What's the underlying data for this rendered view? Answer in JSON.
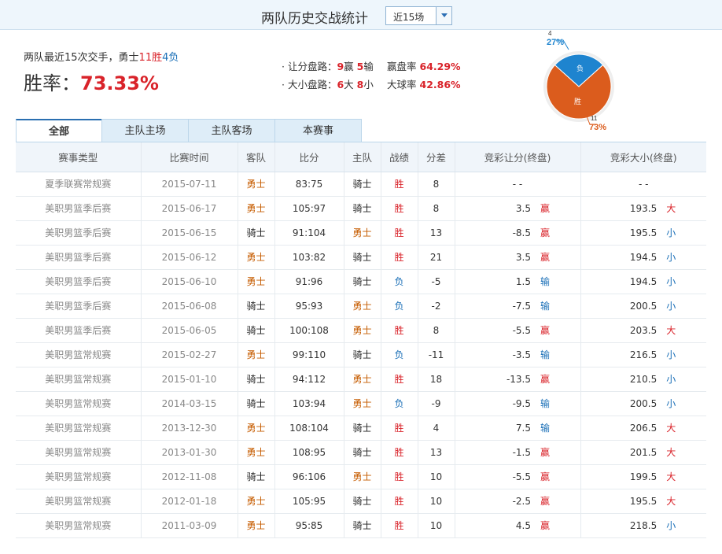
{
  "header": {
    "title": "两队历史交战统计",
    "range_select": {
      "value": "近15场"
    }
  },
  "summary": {
    "prefix": "两队最近15次交手，勇士",
    "wins": "11胜",
    "losses": "4负",
    "winrate_label": "胜率：",
    "winrate_value": "73.33%"
  },
  "stats": {
    "handicap_label": "· 让分盘路：",
    "handicap_win_count": "9",
    "handicap_win_word": "赢",
    "handicap_lose_count": "5",
    "handicap_lose_word": "输",
    "handicap_rate_label": "赢盘率",
    "handicap_rate": "64.29%",
    "ou_label": "· 大小盘路：",
    "ou_big_count": "6",
    "ou_big_word": "大",
    "ou_small_count": "8",
    "ou_small_word": "小",
    "ou_rate_label": "大球率",
    "ou_rate": "42.86%"
  },
  "pie": {
    "colors": {
      "win": "#db5c1d",
      "lose": "#1e84cf"
    },
    "win": {
      "label": "胜",
      "count": "11",
      "percent": "73%",
      "fraction": 0.7333
    },
    "lose": {
      "label": "负",
      "count": "4",
      "percent": "27%",
      "fraction": 0.2667
    }
  },
  "tabs": [
    "全部",
    "主队主场",
    "主队客场",
    "本赛事"
  ],
  "table": {
    "headers": [
      "赛事类型",
      "比赛时间",
      "客队",
      "比分",
      "主队",
      "战绩",
      "分差",
      "竞彩让分(终盘)",
      "竞彩大小(终盘)"
    ],
    "rows": [
      {
        "type": "夏季联赛常规赛",
        "date": "2015-07-11",
        "away": "勇士",
        "score": "83:75",
        "home": "骑士",
        "result": "胜",
        "diff": "8",
        "hc": "- -",
        "hc_mark": "",
        "ou": "- -",
        "ou_mark": ""
      },
      {
        "type": "美职男篮季后赛",
        "date": "2015-06-17",
        "away": "勇士",
        "score": "105:97",
        "home": "骑士",
        "result": "胜",
        "diff": "8",
        "hc": "3.5",
        "hc_mark": "赢",
        "ou": "193.5",
        "ou_mark": "大"
      },
      {
        "type": "美职男篮季后赛",
        "date": "2015-06-15",
        "away": "骑士",
        "score": "91:104",
        "home": "勇士",
        "result": "胜",
        "diff": "13",
        "hc": "-8.5",
        "hc_mark": "赢",
        "ou": "195.5",
        "ou_mark": "小"
      },
      {
        "type": "美职男篮季后赛",
        "date": "2015-06-12",
        "away": "勇士",
        "score": "103:82",
        "home": "骑士",
        "result": "胜",
        "diff": "21",
        "hc": "3.5",
        "hc_mark": "赢",
        "ou": "194.5",
        "ou_mark": "小"
      },
      {
        "type": "美职男篮季后赛",
        "date": "2015-06-10",
        "away": "勇士",
        "score": "91:96",
        "home": "骑士",
        "result": "负",
        "diff": "-5",
        "hc": "1.5",
        "hc_mark": "输",
        "ou": "194.5",
        "ou_mark": "小"
      },
      {
        "type": "美职男篮季后赛",
        "date": "2015-06-08",
        "away": "骑士",
        "score": "95:93",
        "home": "勇士",
        "result": "负",
        "diff": "-2",
        "hc": "-7.5",
        "hc_mark": "输",
        "ou": "200.5",
        "ou_mark": "小"
      },
      {
        "type": "美职男篮季后赛",
        "date": "2015-06-05",
        "away": "骑士",
        "score": "100:108",
        "home": "勇士",
        "result": "胜",
        "diff": "8",
        "hc": "-5.5",
        "hc_mark": "赢",
        "ou": "203.5",
        "ou_mark": "大"
      },
      {
        "type": "美职男篮常规赛",
        "date": "2015-02-27",
        "away": "勇士",
        "score": "99:110",
        "home": "骑士",
        "result": "负",
        "diff": "-11",
        "hc": "-3.5",
        "hc_mark": "输",
        "ou": "216.5",
        "ou_mark": "小"
      },
      {
        "type": "美职男篮常规赛",
        "date": "2015-01-10",
        "away": "骑士",
        "score": "94:112",
        "home": "勇士",
        "result": "胜",
        "diff": "18",
        "hc": "-13.5",
        "hc_mark": "赢",
        "ou": "210.5",
        "ou_mark": "小"
      },
      {
        "type": "美职男篮常规赛",
        "date": "2014-03-15",
        "away": "骑士",
        "score": "103:94",
        "home": "勇士",
        "result": "负",
        "diff": "-9",
        "hc": "-9.5",
        "hc_mark": "输",
        "ou": "200.5",
        "ou_mark": "小"
      },
      {
        "type": "美职男篮常规赛",
        "date": "2013-12-30",
        "away": "勇士",
        "score": "108:104",
        "home": "骑士",
        "result": "胜",
        "diff": "4",
        "hc": "7.5",
        "hc_mark": "输",
        "ou": "206.5",
        "ou_mark": "大"
      },
      {
        "type": "美职男篮常规赛",
        "date": "2013-01-30",
        "away": "勇士",
        "score": "108:95",
        "home": "骑士",
        "result": "胜",
        "diff": "13",
        "hc": "-1.5",
        "hc_mark": "赢",
        "ou": "201.5",
        "ou_mark": "大"
      },
      {
        "type": "美职男篮常规赛",
        "date": "2012-11-08",
        "away": "骑士",
        "score": "96:106",
        "home": "勇士",
        "result": "胜",
        "diff": "10",
        "hc": "-5.5",
        "hc_mark": "赢",
        "ou": "199.5",
        "ou_mark": "大"
      },
      {
        "type": "美职男篮常规赛",
        "date": "2012-01-18",
        "away": "勇士",
        "score": "105:95",
        "home": "骑士",
        "result": "胜",
        "diff": "10",
        "hc": "-2.5",
        "hc_mark": "赢",
        "ou": "195.5",
        "ou_mark": "大"
      },
      {
        "type": "美职男篮常规赛",
        "date": "2011-03-09",
        "away": "勇士",
        "score": "95:85",
        "home": "骑士",
        "result": "胜",
        "diff": "10",
        "hc": "4.5",
        "hc_mark": "赢",
        "ou": "218.5",
        "ou_mark": "小"
      }
    ]
  }
}
